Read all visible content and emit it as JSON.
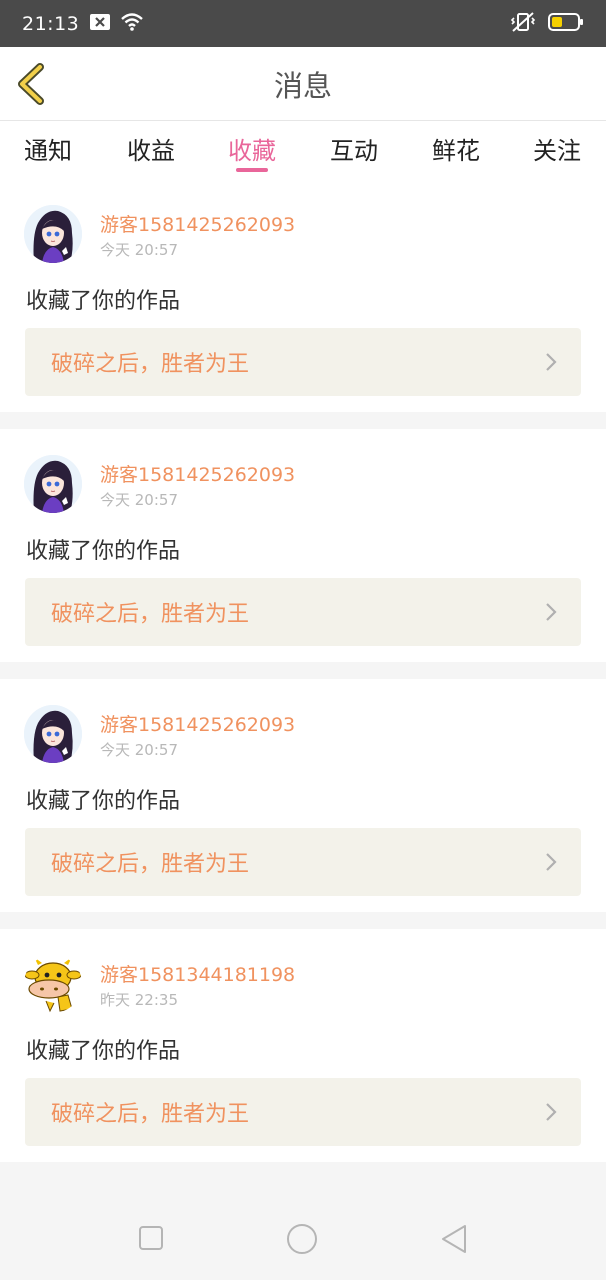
{
  "status_bar": {
    "time": "21:13",
    "icons": [
      "notification-close-icon",
      "wifi-icon",
      "vibrate-mode-icon",
      "battery-icon"
    ]
  },
  "header": {
    "title": "消息",
    "back_icon": "chevron-left-icon"
  },
  "tabs": [
    {
      "label": "通知",
      "active": false
    },
    {
      "label": "收益",
      "active": false
    },
    {
      "label": "收藏",
      "active": true
    },
    {
      "label": "互动",
      "active": false
    },
    {
      "label": "鲜花",
      "active": false
    },
    {
      "label": "关注",
      "active": false
    }
  ],
  "colors": {
    "accent": "#e9669a",
    "username": "#f0925f",
    "link_bg": "#f3f2ea"
  },
  "messages": [
    {
      "username": "游客1581425262093",
      "time": "今天 20:57",
      "action": "收藏了你的作品",
      "work_title": "破碎之后，胜者为王",
      "avatar": "anime-girl-avatar"
    },
    {
      "username": "游客1581425262093",
      "time": "今天 20:57",
      "action": "收藏了你的作品",
      "work_title": "破碎之后，胜者为王",
      "avatar": "anime-girl-avatar"
    },
    {
      "username": "游客1581425262093",
      "time": "今天 20:57",
      "action": "收藏了你的作品",
      "work_title": "破碎之后，胜者为王",
      "avatar": "anime-girl-avatar"
    },
    {
      "username": "游客1581344181198",
      "time": "昨天 22:35",
      "action": "收藏了你的作品",
      "work_title": "破碎之后，胜者为王",
      "avatar": "cartoon-cow-avatar"
    }
  ],
  "nav_bar": {
    "icons": [
      "recents-square-icon",
      "home-circle-icon",
      "back-triangle-icon"
    ]
  }
}
